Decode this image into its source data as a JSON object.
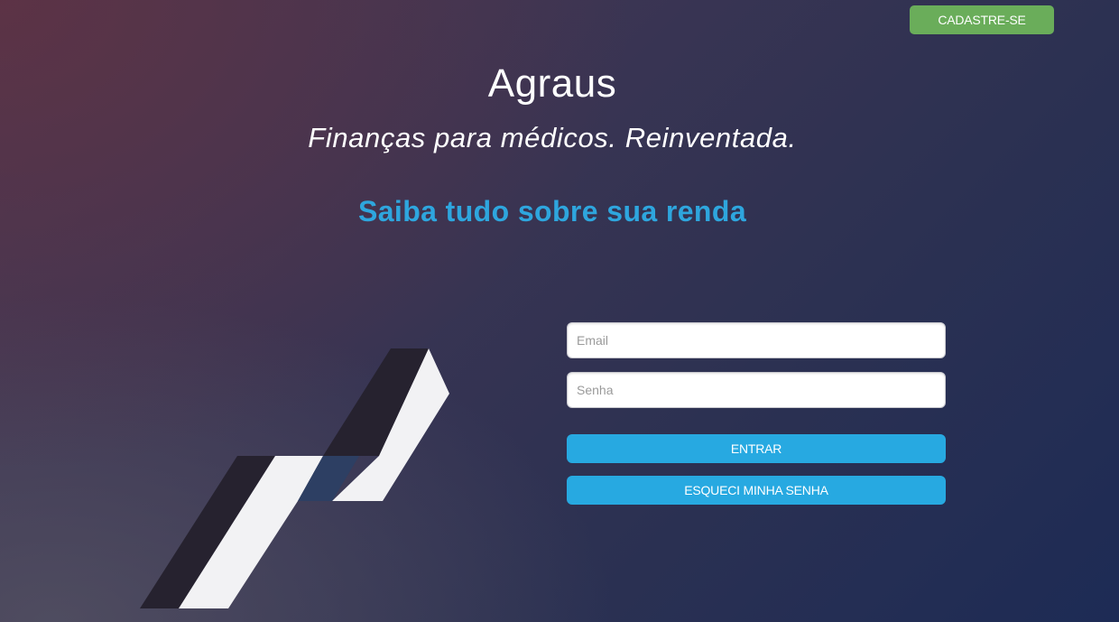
{
  "header": {
    "signup_label": "CADASTRE-SE"
  },
  "hero": {
    "title": "Agraus",
    "tagline": "Finanças para médicos. Reinventada.",
    "subtitle": "Saiba tudo sobre sua renda"
  },
  "login": {
    "email_placeholder": "Email",
    "email_value": "",
    "password_placeholder": "Senha",
    "password_value": "",
    "enter_label": "ENTRAR",
    "forgot_label": "ESQUECI MINHA SENHA"
  },
  "logo": {
    "icon": "agraus-logo-mark"
  },
  "colors": {
    "accent_blue": "#27a9e1",
    "subtitle_blue": "#2ea6de",
    "signup_green": "#6aad5a",
    "logo_light": "#f2f2f4",
    "logo_dark": "#26222f",
    "logo_overlap": "#2d3f63"
  }
}
